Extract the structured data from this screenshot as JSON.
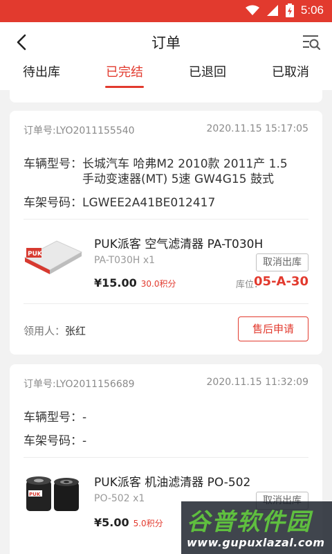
{
  "status_bar": {
    "time": "5:06"
  },
  "header": {
    "title": "订单"
  },
  "tabs": [
    {
      "label": "待出库",
      "active": false
    },
    {
      "label": "已完结",
      "active": true
    },
    {
      "label": "已退回",
      "active": false
    },
    {
      "label": "已取消",
      "active": false
    }
  ],
  "orders": [
    {
      "order_no": "订单号:LYO2011155540",
      "time": "2020.11.15 15:17:05",
      "vehicle_label": "车辆型号：",
      "vehicle_value": "长城汽车 哈弗M2 2010款 2011产 1.5 手动变速器(MT) 5速 GW4G15  鼓式",
      "vin_label": "车架号码：",
      "vin_value": "LGWEE2A41BE012417",
      "product": {
        "name": "PUK派客 空气滤清器 PA-T030H",
        "code_qty": "PA-T030H x1",
        "cancel_label": "取消出库",
        "price": "¥15.00",
        "points": "30.0积分",
        "location_label": "库位：",
        "location": "05-A-30"
      },
      "receiver_label": "领用人：",
      "receiver_name": "张红",
      "after_sale_label": "售后申请"
    },
    {
      "order_no": "订单号:LYO2011156689",
      "time": "2020.11.15 11:32:09",
      "vehicle_label": "车辆型号：",
      "vehicle_value": "-",
      "vin_label": "车架号码：",
      "vin_value": "-",
      "product": {
        "name": "PUK派客 机油滤清器 PO-502",
        "code_qty": "PO-502 x1",
        "cancel_label": "取消出库",
        "price": "¥5.00",
        "points": "5.0积分"
      }
    }
  ],
  "watermark": {
    "brand": "谷普软件园",
    "url": "www.gupuxlazal.com"
  },
  "colors": {
    "accent": "#e23a2e",
    "status_bar": "#e23a2e"
  }
}
